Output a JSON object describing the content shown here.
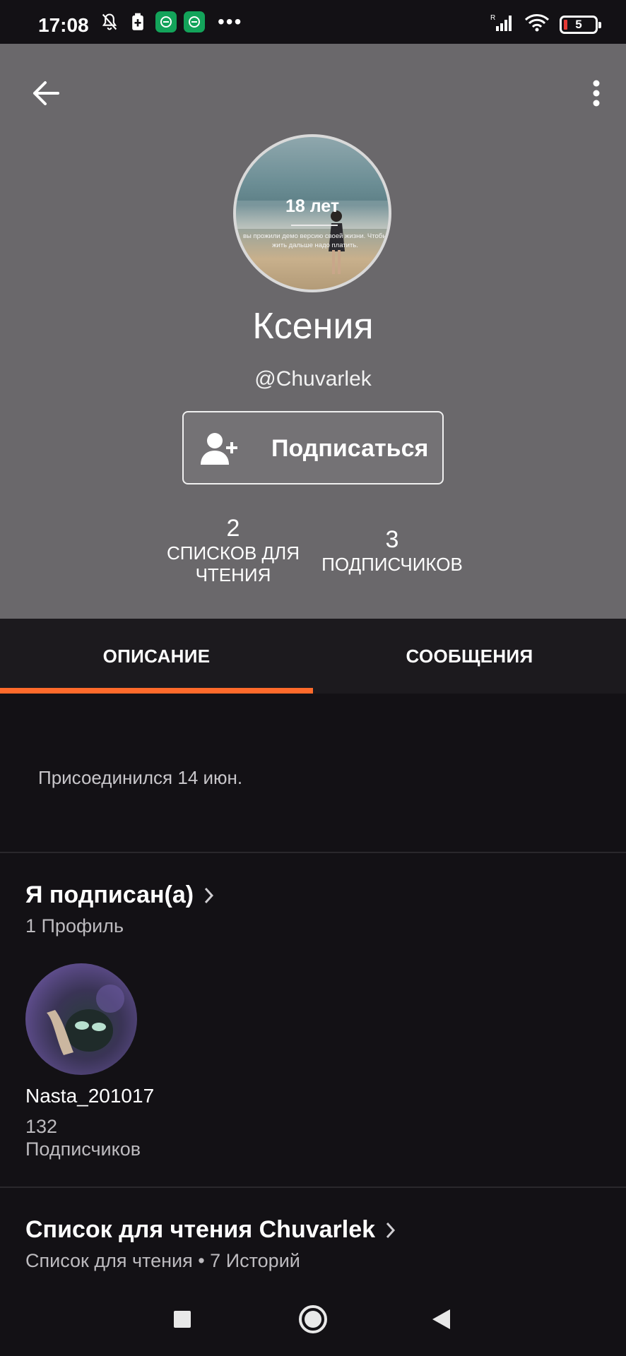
{
  "status_bar": {
    "time": "17:08",
    "battery_level": "5",
    "icons": [
      "bell-off-icon",
      "battery-saver-icon",
      "app-icon",
      "app-icon",
      "more-dots-icon",
      "signal-icon",
      "wifi-icon",
      "battery-icon"
    ],
    "more": "•••"
  },
  "header": {
    "avatar": {
      "title": "18 лет",
      "caption": "вы прожили демо версию своей жизни. Чтобы жить дальше надо платить."
    },
    "name": "Ксения",
    "handle": "@Chuvarlek",
    "follow_button": "Подписаться",
    "stats": {
      "reading_lists_value": "2",
      "reading_lists_label": "СПИСКОВ ДЛЯ ЧТЕНИЯ",
      "followers_value": "3",
      "followers_label": "ПОДПИСЧИКОВ"
    }
  },
  "tabs": [
    {
      "label": "ОПИСАНИЕ",
      "active": true
    },
    {
      "label": "СООБЩЕНИЯ",
      "active": false
    }
  ],
  "about": {
    "joined": "Присоединился 14 июн."
  },
  "following": {
    "title": "Я подписан(а)",
    "subtitle": "1 Профиль",
    "profiles": [
      {
        "name": "Nasta_201017",
        "followers_count": "132",
        "followers_label": "Подписчиков"
      }
    ]
  },
  "reading_list": {
    "title": "Список для чтения Chuvarlek",
    "subtitle": "Список для чтения • 7 Историй"
  },
  "colors": {
    "accent": "#ff6a2b",
    "header_bg": "#6a686b",
    "page_bg": "#131115"
  }
}
